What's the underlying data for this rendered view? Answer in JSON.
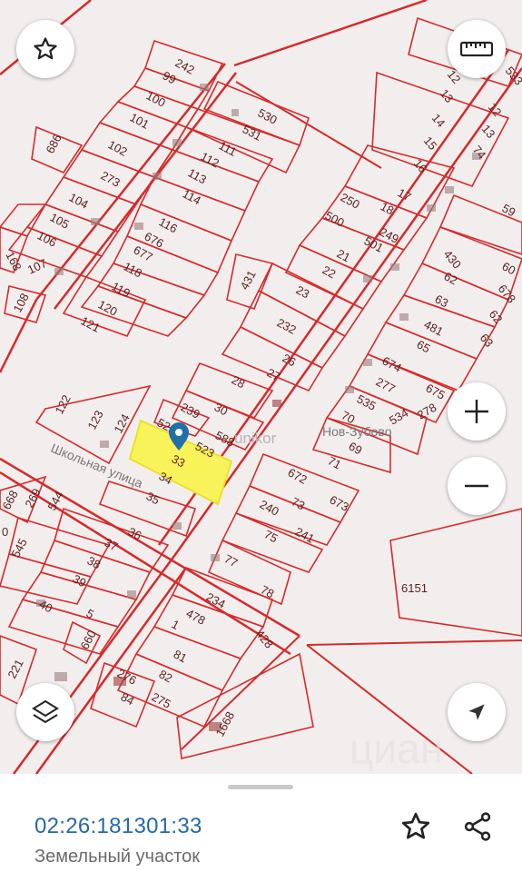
{
  "map": {
    "street_label": "Школьная улица",
    "village_label": "Нов-Зубово",
    "watermark_text": "unikor",
    "watermark_brand": "циан",
    "big_parcel": "6151",
    "highlighted_parcel": "33",
    "parcel_numbers": {
      "p242": "242",
      "p99": "99",
      "p100": "100",
      "p101": "101",
      "p102": "102",
      "p273": "273",
      "p686": "686",
      "p104": "104",
      "p105": "105",
      "p106": "106",
      "p168": "168",
      "p107": "107",
      "p108": "108",
      "p121": "121",
      "p120": "120",
      "p119": "119",
      "p118": "118",
      "p677": "677",
      "p676": "676",
      "p116": "116",
      "p114": "114",
      "p113": "113",
      "p112": "112",
      "p111": "111",
      "p531": "531",
      "p530": "530",
      "p17": "17",
      "p18": "18",
      "p250": "250",
      "p500": "500",
      "p249": "249",
      "p21": "21",
      "p501": "501",
      "p22": "22",
      "p431": "431",
      "p23": "23",
      "p232": "232",
      "p26": "26",
      "p27": "27",
      "p28": "28",
      "p30": "30",
      "p239": "239",
      "p522": "522",
      "p523": "523",
      "p588": "588",
      "p34": "34",
      "p35": "35",
      "p122": "122",
      "p123": "123",
      "p124": "124",
      "p12a": "12",
      "p13a": "13",
      "p14": "14",
      "p15": "15",
      "p16": "16",
      "p12b": "12",
      "p13b": "13",
      "p74": "74",
      "p533": "533",
      "p59": "59",
      "p430": "430",
      "p60": "60",
      "p62a": "62",
      "p678": "678",
      "p63a": "63",
      "p62b": "62",
      "p481": "481",
      "p63b": "63",
      "p65": "65",
      "p674": "674",
      "p675": "675",
      "p277": "277",
      "p535": "535",
      "p534": "534",
      "p278": "278",
      "p70": "70",
      "p69": "69",
      "p71": "71",
      "p672": "672",
      "p73": "73",
      "p673": "673",
      "p240": "240",
      "p241": "241",
      "p75": "75",
      "p77": "77",
      "p78": "78",
      "p234": "234",
      "p478": "478",
      "p428": "428",
      "p1": "1",
      "p81": "81",
      "p82": "82",
      "p276": "276",
      "p84": "84",
      "p275": "275",
      "p1668": "1668",
      "p269": "269",
      "p544": "544",
      "p668": "668",
      "p545": "545",
      "p36": "36",
      "p37": "37",
      "p38": "38",
      "p39": "39",
      "p40": "40",
      "p5": "5",
      "p660": "660",
      "p221": "221",
      "p0": "0"
    }
  },
  "controls": {
    "favorite_map_icon": "star-outline-icon",
    "ruler_icon": "ruler-icon",
    "zoom_in_icon": "plus-icon",
    "zoom_out_icon": "minus-icon",
    "layers_icon": "layers-icon",
    "locate_icon": "navigation-arrow-icon"
  },
  "sheet": {
    "cadastral_number": "02:26:181301:33",
    "object_type": "Земельный участок",
    "favorite_icon": "star-outline-icon",
    "share_icon": "share-icon"
  },
  "colors": {
    "boundary": "#d62a2a",
    "highlight": "#f9f35a",
    "marker": "#1f6fa8",
    "link": "#2468a8"
  }
}
